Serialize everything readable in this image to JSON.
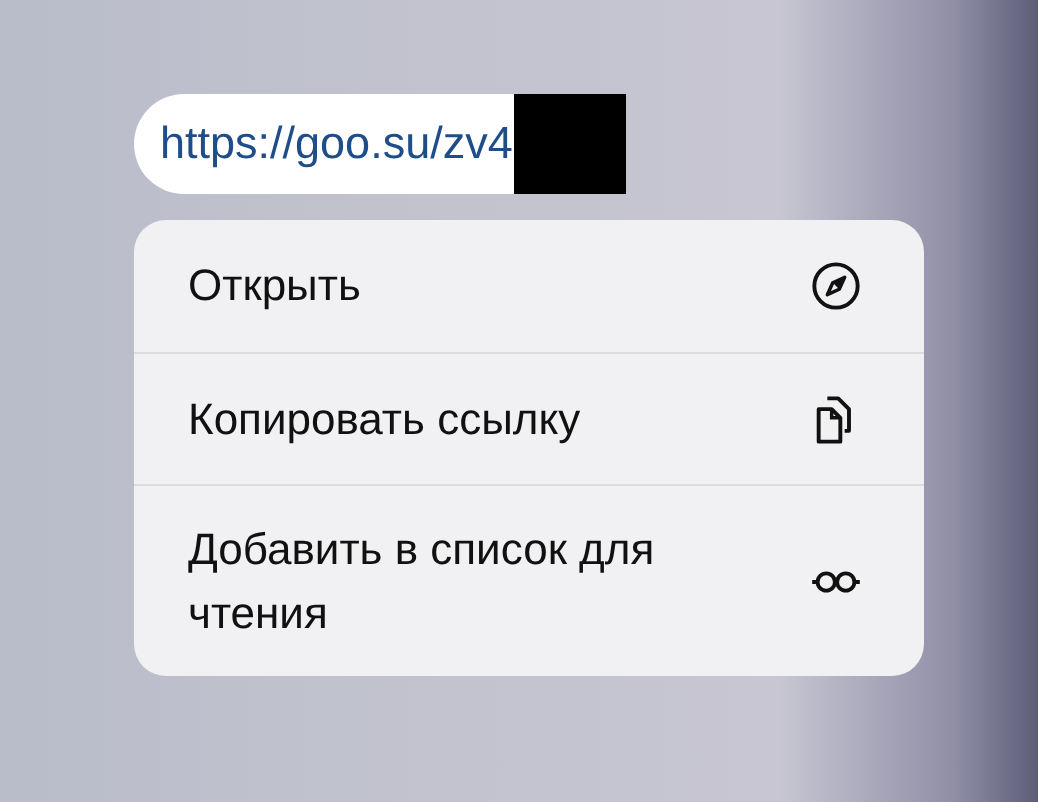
{
  "link": {
    "url": "https://goo.su/zv4",
    "redacted": true
  },
  "menu": {
    "items": [
      {
        "label": "Открыть"
      },
      {
        "label": "Копировать ссылку"
      },
      {
        "label": "Добавить в список для чтения"
      }
    ]
  }
}
